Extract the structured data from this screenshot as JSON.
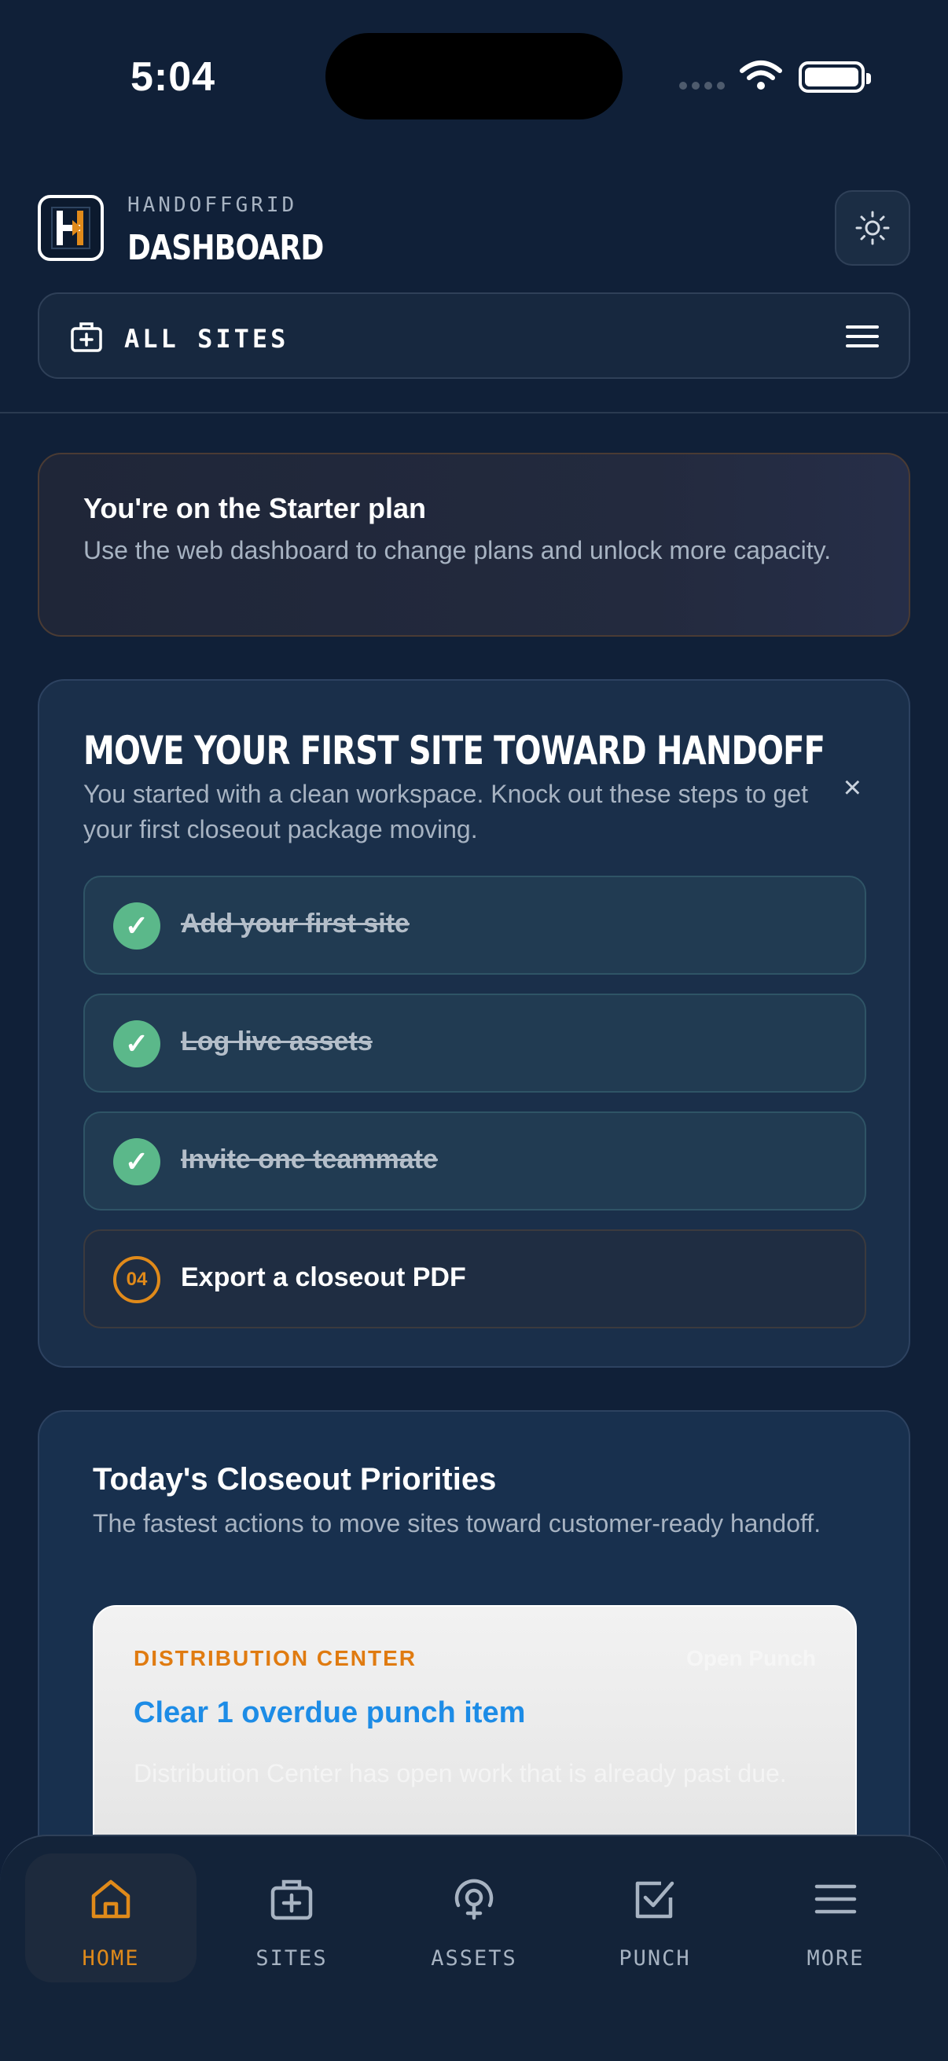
{
  "status_bar": {
    "time": "5:04"
  },
  "header": {
    "brand": "HANDOFFGRID",
    "title": "DASHBOARD",
    "site_selector_label": "ALL SITES"
  },
  "plan_banner": {
    "title": "You're on the Starter plan",
    "description": "Use the web dashboard to change plans and unlock more capacity."
  },
  "onboarding": {
    "title": "MOVE YOUR FIRST SITE TOWARD HANDOFF",
    "description": "You started with a clean workspace. Knock out these steps to get your first closeout package moving.",
    "close_glyph": "×",
    "steps": [
      {
        "label": "Add your first site",
        "done": true,
        "check_glyph": "✓"
      },
      {
        "label": "Log live assets",
        "done": true,
        "check_glyph": "✓"
      },
      {
        "label": "Invite one teammate",
        "done": true,
        "check_glyph": "✓"
      },
      {
        "label": "Export a closeout PDF",
        "done": false,
        "number": "04"
      }
    ]
  },
  "priorities": {
    "title": "Today's Closeout Priorities",
    "description": "The fastest actions to move sites toward customer-ready handoff.",
    "card": {
      "category": "DISTRIBUTION CENTER",
      "tag": "Open Punch",
      "title": "Clear 1 overdue punch item",
      "description": "Distribution Center has open work that is already past due."
    }
  },
  "tab_bar": {
    "active": "HOME",
    "items": [
      {
        "label": "HOME",
        "icon": "home-icon"
      },
      {
        "label": "SITES",
        "icon": "briefcase-plus-icon"
      },
      {
        "label": "ASSETS",
        "icon": "target-icon"
      },
      {
        "label": "PUNCH",
        "icon": "checkbox-icon"
      },
      {
        "label": "MORE",
        "icon": "menu-icon"
      }
    ]
  },
  "colors": {
    "background": "#102038",
    "accent": "#e08a1a",
    "success": "#5bb88a",
    "link": "#1d8ce6"
  }
}
